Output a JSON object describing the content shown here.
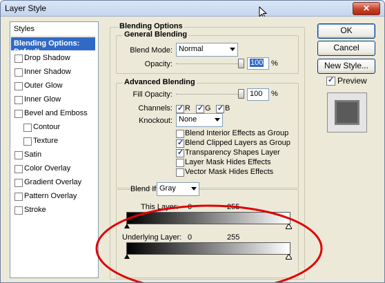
{
  "window": {
    "title": "Layer Style",
    "close_glyph": "✕"
  },
  "styles_list": {
    "header": "Styles",
    "selected": "Blending Options: Default",
    "items": [
      {
        "label": "Drop Shadow",
        "level": 0,
        "checked": false
      },
      {
        "label": "Inner Shadow",
        "level": 0,
        "checked": false
      },
      {
        "label": "Outer Glow",
        "level": 0,
        "checked": false
      },
      {
        "label": "Inner Glow",
        "level": 0,
        "checked": false
      },
      {
        "label": "Bevel and Emboss",
        "level": 0,
        "checked": false
      },
      {
        "label": "Contour",
        "level": 1,
        "checked": false
      },
      {
        "label": "Texture",
        "level": 1,
        "checked": false
      },
      {
        "label": "Satin",
        "level": 0,
        "checked": false
      },
      {
        "label": "Color Overlay",
        "level": 0,
        "checked": false
      },
      {
        "label": "Gradient Overlay",
        "level": 0,
        "checked": false
      },
      {
        "label": "Pattern Overlay",
        "level": 0,
        "checked": false
      },
      {
        "label": "Stroke",
        "level": 0,
        "checked": false
      }
    ]
  },
  "blending": {
    "title": "Blending Options",
    "general": {
      "title": "General Blending",
      "blend_mode_label": "Blend Mode:",
      "blend_mode_value": "Normal",
      "opacity_label": "Opacity:",
      "opacity_value": "100",
      "pct": "%"
    },
    "advanced": {
      "title": "Advanced Blending",
      "fill_opacity_label": "Fill Opacity:",
      "fill_opacity_value": "100",
      "pct": "%",
      "channels_label": "Channels:",
      "channels": [
        {
          "label": "R",
          "checked": true
        },
        {
          "label": "G",
          "checked": true
        },
        {
          "label": "B",
          "checked": true
        }
      ],
      "knockout_label": "Knockout:",
      "knockout_value": "None",
      "options": [
        {
          "label": "Blend Interior Effects as Group",
          "checked": false
        },
        {
          "label": "Blend Clipped Layers as Group",
          "checked": true
        },
        {
          "label": "Transparency Shapes Layer",
          "checked": true
        },
        {
          "label": "Layer Mask Hides Effects",
          "checked": false
        },
        {
          "label": "Vector Mask Hides Effects",
          "checked": false
        }
      ]
    },
    "blend_if": {
      "label": "Blend If:",
      "value": "Gray",
      "this_layer": {
        "label": "This Layer:",
        "min": "0",
        "max": "255"
      },
      "underlying_layer": {
        "label": "Underlying Layer:",
        "min": "0",
        "max": "255"
      }
    }
  },
  "buttons": {
    "ok": "OK",
    "cancel": "Cancel",
    "new_style": "New Style...",
    "preview_label": "Preview",
    "preview_checked": true
  },
  "colors": {
    "selection": "#316ac5",
    "annotation": "#e00000",
    "dialog_bg": "#ece9d8"
  }
}
